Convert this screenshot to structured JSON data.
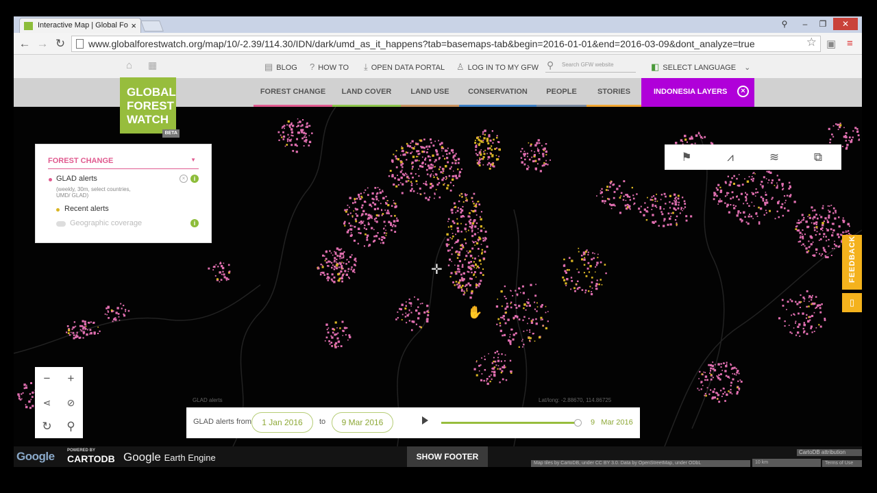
{
  "browser": {
    "tab_title": "Interactive Map | Global Fo",
    "url": "www.globalforestwatch.org/map/10/-2.39/114.30/IDN/dark/umd_as_it_happens?tab=basemaps-tab&begin=2016-01-01&end=2016-03-09&dont_analyze=true"
  },
  "top_links": {
    "blog": "BLOG",
    "how_to": "HOW TO",
    "open_data": "OPEN DATA PORTAL",
    "login": "LOG IN TO MY GFW",
    "search_placeholder": "Search GFW website",
    "language": "SELECT LANGUAGE"
  },
  "logo": {
    "line1": "GLOBAL",
    "line2": "FOREST",
    "line3": "WATCH",
    "badge": "BETA"
  },
  "nav": {
    "items": [
      "FOREST CHANGE",
      "LAND COVER",
      "LAND USE",
      "CONSERVATION",
      "PEOPLE",
      "STORIES"
    ],
    "active": "INDONESIA LAYERS"
  },
  "layer_panel": {
    "header": "FOREST CHANGE",
    "layer_name": "GLAD alerts",
    "layer_desc_1": "(weekly, 30m, select countries,",
    "layer_desc_2": "UMD/ GLAD)",
    "recent": "Recent alerts",
    "coverage": "Geographic coverage"
  },
  "timeline": {
    "label": "GLAD alerts from",
    "start": "1 Jan 2016",
    "to": "to",
    "end": "9 Mar 2016",
    "current_day": "9",
    "current_month": "Mar 2016",
    "progress": 1.0
  },
  "map_labels": {
    "layer": "GLAD alerts",
    "coords": "Lat/long: -2.88670, 114.86725"
  },
  "feedback": "FEEDBACK",
  "footer": {
    "google": "Google",
    "powered_by": "POWERED BY",
    "carto": "CARTODB",
    "gee_1": "Google",
    "gee_2": "Earth Engine",
    "show_footer": "SHOW FOOTER",
    "carto_attr": "CartoDB attribution",
    "attribution": "Map tiles by CartoDB, under CC BY 3.0. Data by OpenStreetMap, under ODbL",
    "scale": "10 km",
    "terms": "Terms of Use"
  },
  "colors": {
    "alert_pink": "#e06fb0",
    "alert_yellow": "#d9b523",
    "brand_green": "#97bd3d",
    "indonesia_purple": "#b000d9",
    "feedback_orange": "#f4b21d"
  },
  "icons": {
    "tools": [
      "flag-search-icon",
      "chart-icon",
      "layers-icon",
      "share-map-icon"
    ],
    "zoom": [
      "zoom-out-icon",
      "zoom-in-icon",
      "share-icon",
      "hide-icon",
      "reset-icon",
      "search-icon"
    ]
  }
}
